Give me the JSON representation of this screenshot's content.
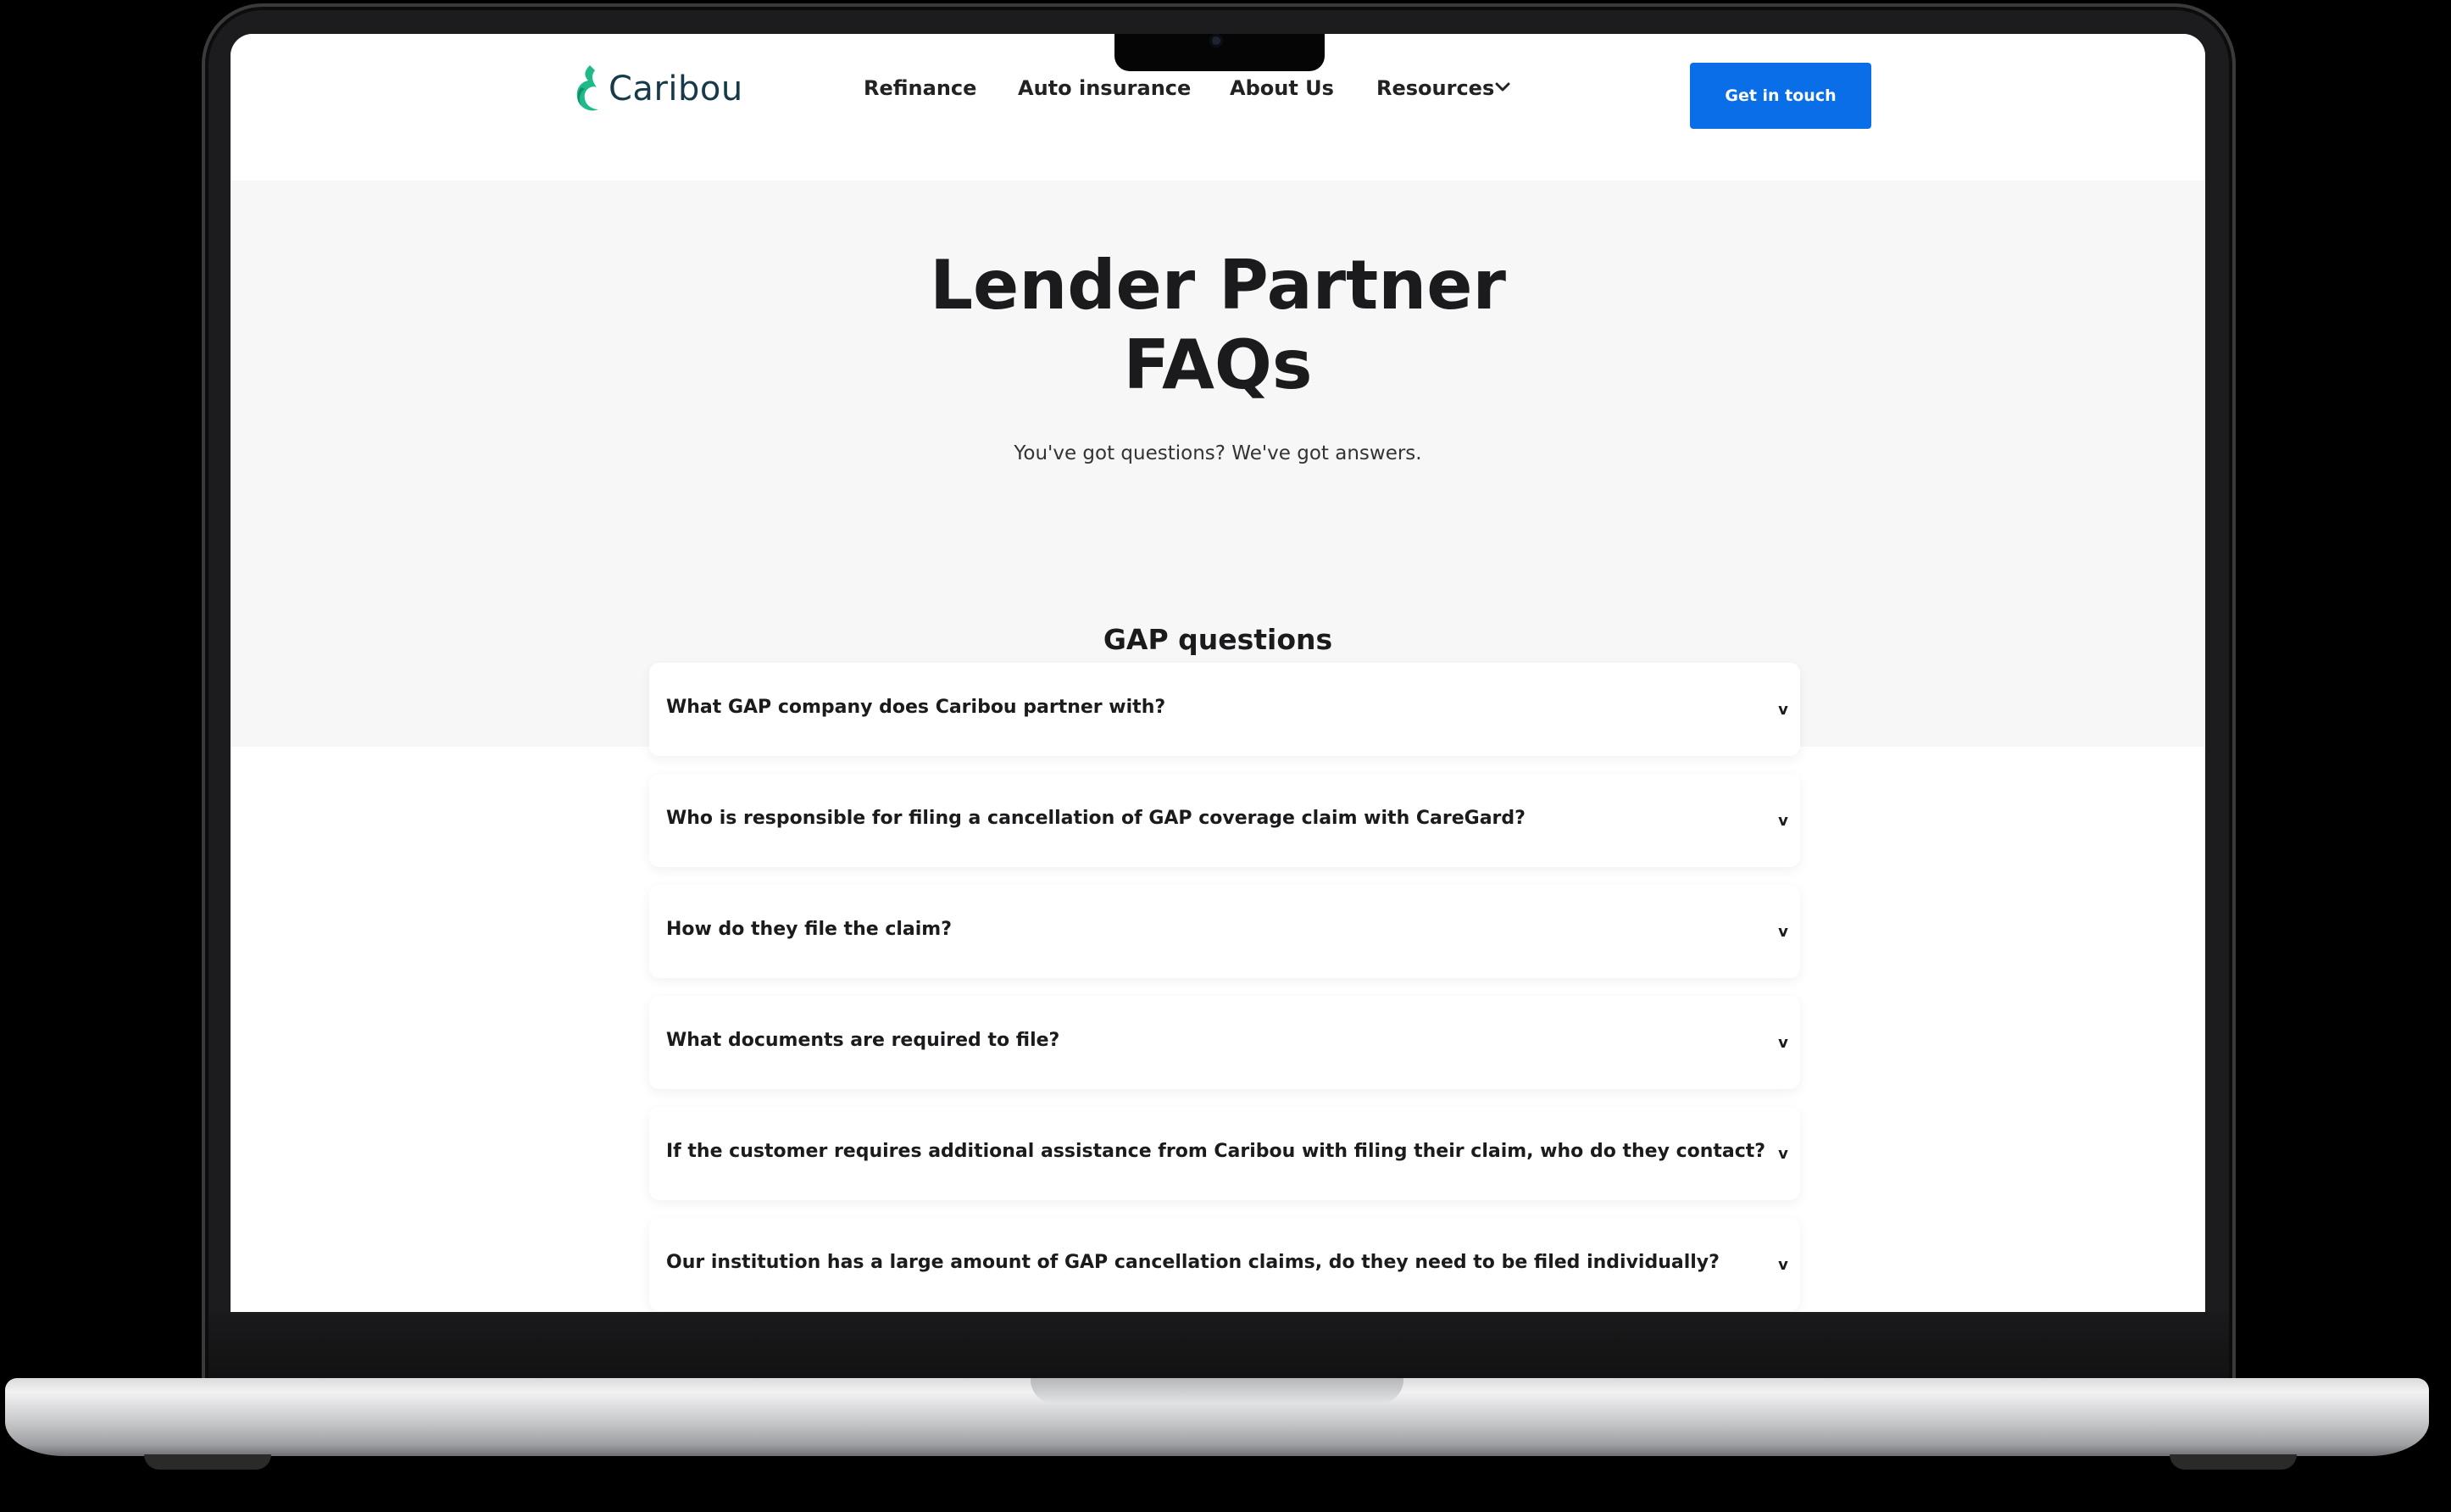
{
  "brand": {
    "name": "Caribou",
    "accent": "#0a6ee8",
    "logo_color": "#1fb98a"
  },
  "nav": {
    "items": [
      {
        "label": "Refinance"
      },
      {
        "label": "Auto insurance"
      },
      {
        "label": "About Us"
      },
      {
        "label": "Resources"
      }
    ],
    "resources_icon": "chevron-down-icon",
    "cta_label": "Get in touch"
  },
  "hero": {
    "title_line1": "Lender Partner",
    "title_line2": "FAQs",
    "subtitle": "You've got questions? We've got answers."
  },
  "faq_section": {
    "title": "GAP questions",
    "toggle_glyph": "v",
    "items": [
      {
        "question": "What GAP company does Caribou partner with?"
      },
      {
        "question": "Who is responsible for filing a cancellation of GAP coverage claim with CareGard?"
      },
      {
        "question": "How do they file the claim?"
      },
      {
        "question": "What documents are required to file?"
      },
      {
        "question": "If the customer requires additional assistance from Caribou with filing their claim, who do they contact?"
      },
      {
        "question": "Our institution has a large amount of GAP cancellation claims, do they need to be filed individually?"
      }
    ]
  }
}
